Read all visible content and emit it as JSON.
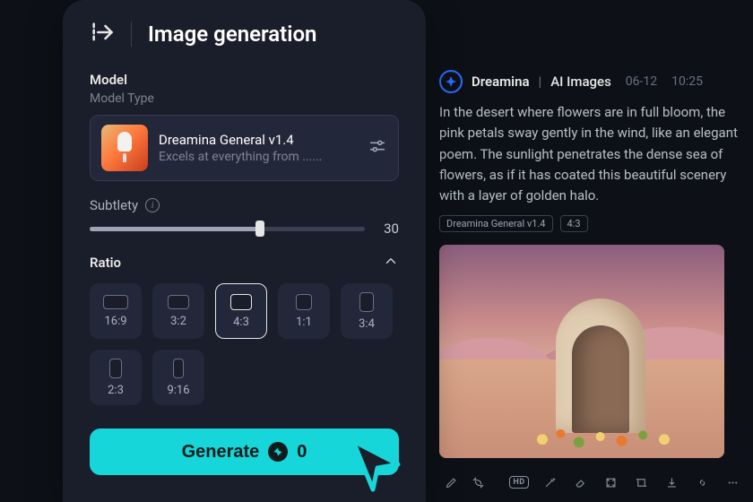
{
  "panel": {
    "title": "Image generation",
    "model_section_label": "Model",
    "model_type_label": "Model Type",
    "model": {
      "name": "Dreamina General v1.4",
      "desc": "Excels at everything from ......"
    },
    "subtlety": {
      "label": "Subtlety",
      "value": "30"
    },
    "ratio": {
      "label": "Ratio",
      "options": [
        {
          "label": "16:9",
          "w": 28,
          "h": 16
        },
        {
          "label": "3:2",
          "w": 24,
          "h": 16
        },
        {
          "label": "4:3",
          "w": 24,
          "h": 18,
          "selected": true
        },
        {
          "label": "1:1",
          "w": 18,
          "h": 18
        },
        {
          "label": "3:4",
          "w": 16,
          "h": 22
        },
        {
          "label": "2:3",
          "w": 14,
          "h": 22
        },
        {
          "label": "9:16",
          "w": 12,
          "h": 22
        }
      ]
    },
    "generate": {
      "label": "Generate",
      "credits": "0"
    }
  },
  "result": {
    "brand": "Dreamina",
    "section": "AI Images",
    "date": "06-12",
    "time": "10:25",
    "prompt": "In the desert where flowers are in full bloom, the pink petals sway gently in the wind, like an elegant poem. The sunlight penetrates the dense sea of flowers, as if it has coated this beautiful scenery with a layer of golden halo.",
    "tags": {
      "model": "Dreamina General v1.4",
      "ratio": "4:3"
    },
    "toolbar": {
      "hd": "HD"
    }
  }
}
